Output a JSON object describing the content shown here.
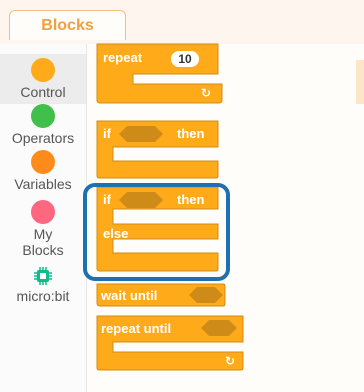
{
  "tab": {
    "label": "Blocks"
  },
  "categories": [
    {
      "id": "control",
      "label": "Control",
      "color": "#ffab19",
      "icon": "orange-circle-icon",
      "active": true
    },
    {
      "id": "operators",
      "label": "Operators",
      "color": "#40bf4a",
      "icon": "green-circle-icon"
    },
    {
      "id": "variables",
      "label": "Variables",
      "color": "#ff8c1a",
      "icon": "orange-circle-icon"
    },
    {
      "id": "my-blocks",
      "label": "My\nBlocks",
      "color": "#ff6680",
      "icon": "pink-circle-icon"
    },
    {
      "id": "microbit",
      "label": "micro:bit",
      "color": "#0fbd8c",
      "icon": "microchip-icon"
    }
  ],
  "blocks": {
    "repeat": {
      "label": "repeat",
      "count": "10"
    },
    "if_then": {
      "if_label": "if",
      "then_label": "then"
    },
    "if_else": {
      "if_label": "if",
      "then_label": "then",
      "else_label": "else"
    },
    "wait_until": {
      "label": "wait until"
    },
    "repeat_until": {
      "label": "repeat until"
    }
  },
  "colors": {
    "block_fill": "#ffab19",
    "block_stroke": "#cf8b17",
    "hex_fill": "#cf8b17",
    "highlight": "#1f6fb3"
  }
}
